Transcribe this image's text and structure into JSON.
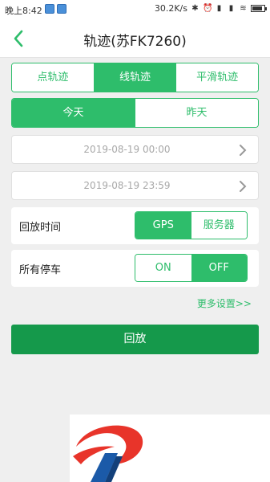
{
  "status_bar": {
    "time": "晚上8:42",
    "speed": "30.2K/s",
    "battery_level": 0.85
  },
  "header": {
    "title": "轨迹(苏FK7260)"
  },
  "track_tabs": [
    {
      "label": "点轨迹",
      "active": false
    },
    {
      "label": "线轨迹",
      "active": true
    },
    {
      "label": "平滑轨迹",
      "active": false
    }
  ],
  "day_tabs": [
    {
      "label": "今天",
      "active": true
    },
    {
      "label": "昨天",
      "active": false
    }
  ],
  "start_time": "2019-08-19 00:00",
  "end_time": "2019-08-19 23:59",
  "playback_time": {
    "label": "回放时间",
    "options": [
      {
        "label": "GPS",
        "active": true
      },
      {
        "label": "服务器",
        "active": false
      }
    ]
  },
  "all_parking": {
    "label": "所有停车",
    "options": [
      {
        "label": "ON",
        "active": false
      },
      {
        "label": "OFF",
        "active": true
      }
    ]
  },
  "more_settings": "更多设置>>",
  "playback_button": "回放",
  "colors": {
    "accent": "#2ebd6b",
    "button": "#15994b"
  }
}
